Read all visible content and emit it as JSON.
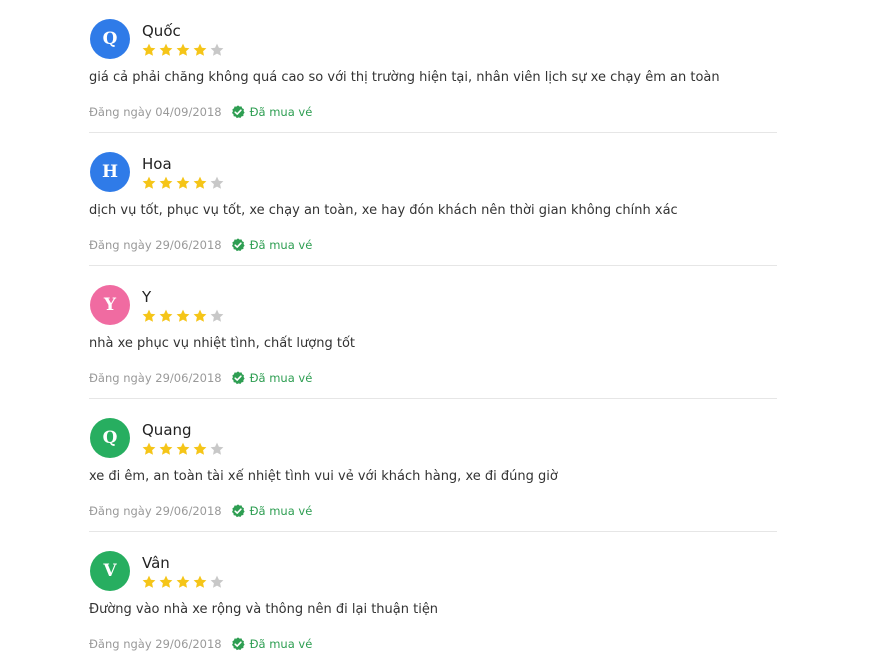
{
  "reviews": [
    {
      "initial": "Q",
      "avatar_color": "#2f7be8",
      "name": "Quốc",
      "rating": 4,
      "max_rating": 5,
      "comment": "giá cả phải chăng không quá cao so với thị trường hiện tại, nhân viên lịch sự xe chạy êm an toàn",
      "date": "Đăng ngày 04/09/2018",
      "badge": "Đã mua vé"
    },
    {
      "initial": "H",
      "avatar_color": "#2f7be8",
      "name": "Hoa",
      "rating": 4,
      "max_rating": 5,
      "comment": "dịch vụ tốt, phục vụ tốt, xe chạy an toàn, xe hay đón khách nên thời gian không chính xác",
      "date": "Đăng ngày 29/06/2018",
      "badge": "Đã mua vé"
    },
    {
      "initial": "Y",
      "avatar_color": "#f06ba1",
      "name": "Y",
      "rating": 4,
      "max_rating": 5,
      "comment": "nhà xe phục vụ nhiệt tình, chất lượng tốt",
      "date": "Đăng ngày 29/06/2018",
      "badge": "Đã mua vé"
    },
    {
      "initial": "Q",
      "avatar_color": "#27ae60",
      "name": "Quang",
      "rating": 4,
      "max_rating": 5,
      "comment": "xe đi êm, an toàn tài xế nhiệt tình vui vẻ với khách hàng, xe đi đúng giờ",
      "date": "Đăng ngày 29/06/2018",
      "badge": "Đã mua vé"
    },
    {
      "initial": "V",
      "avatar_color": "#27ae60",
      "name": "Vân",
      "rating": 4,
      "max_rating": 5,
      "comment": "Đường vào nhà xe rộng và thông nên đi lại thuận tiện",
      "date": "Đăng ngày 29/06/2018",
      "badge": "Đã mua vé"
    }
  ],
  "colors": {
    "star_filled": "#f5c518",
    "star_empty": "#c8c8c8",
    "verified": "#2e9e52"
  },
  "icons": {
    "rating": "star-icon",
    "verified": "verified-check-icon"
  }
}
